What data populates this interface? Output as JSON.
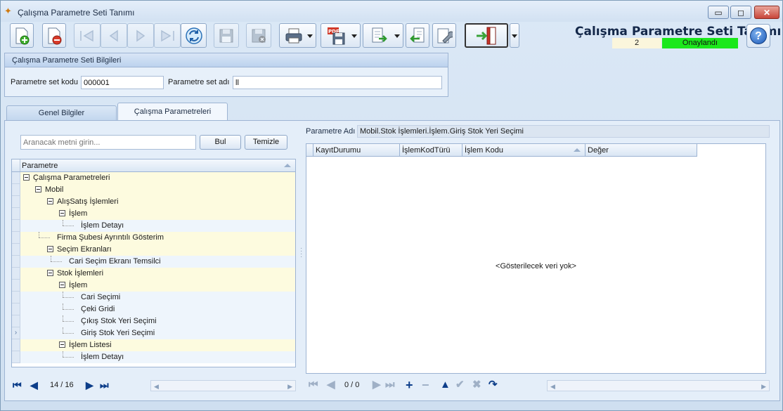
{
  "window": {
    "title": "Çalışma Parametre Seti Tanımı",
    "controls": {
      "minimize": "▭",
      "maximize": "◻",
      "close": "✕"
    }
  },
  "toolbar": {
    "buttons": [
      {
        "name": "new-record-button",
        "icon": "new-document-icon",
        "enabled": true
      },
      {
        "name": "delete-record-button",
        "icon": "delete-document-icon",
        "enabled": true
      },
      {
        "name": "first-record-button",
        "icon": "first-icon",
        "enabled": false
      },
      {
        "name": "prev-record-button",
        "icon": "prev-icon",
        "enabled": false
      },
      {
        "name": "next-record-button",
        "icon": "next-icon",
        "enabled": false
      },
      {
        "name": "last-record-button",
        "icon": "last-icon",
        "enabled": false
      },
      {
        "name": "refresh-button",
        "icon": "refresh-icon",
        "enabled": true
      },
      {
        "name": "save-button",
        "icon": "save-icon",
        "enabled": false
      },
      {
        "name": "cancel-save-button",
        "icon": "save-cancel-icon",
        "enabled": false
      },
      {
        "name": "print-button",
        "icon": "printer-icon",
        "enabled": true
      },
      {
        "name": "pdf-export-button",
        "icon": "pdf-icon",
        "enabled": true
      },
      {
        "name": "export-button",
        "icon": "export-icon",
        "enabled": true
      },
      {
        "name": "import-button",
        "icon": "import-icon",
        "enabled": true
      },
      {
        "name": "tools-button",
        "icon": "wrench-icon",
        "enabled": true
      },
      {
        "name": "exit-button",
        "icon": "exit-door-icon",
        "enabled": true
      }
    ]
  },
  "header": {
    "form_title": "Çalışma Parametre Seti Tanımı",
    "record_number": "2",
    "status": "Onaylandı",
    "status_color": "#1be81b",
    "help": "?"
  },
  "info_group": {
    "title": "Çalışma Parametre Seti Bilgileri",
    "code_label": "Parametre set kodu",
    "code_value": "000001",
    "name_label": "Parametre set adı",
    "name_value": "ll"
  },
  "tabs": [
    {
      "label": "Genel Bilgiler",
      "active": false
    },
    {
      "label": "Çalışma Parametreleri",
      "active": true
    }
  ],
  "left": {
    "search_placeholder": "Aranacak metni girin...",
    "find_button": "Bul",
    "clear_button": "Temizle",
    "tree_header": "Parametre",
    "rows": [
      {
        "label": "Çalışma Parametreleri",
        "level": 0,
        "expander": true,
        "tone": "yellow"
      },
      {
        "label": "Mobil",
        "level": 1,
        "expander": true,
        "tone": "yellow"
      },
      {
        "label": "AlışSatış İşlemleri",
        "level": 2,
        "expander": true,
        "tone": "yellow"
      },
      {
        "label": "İşlem",
        "level": 3,
        "expander": true,
        "tone": "yellow"
      },
      {
        "label": "İşlem Detayı",
        "level": 4,
        "expander": false,
        "tone": "blue"
      },
      {
        "label": "Firma Şubesi Ayrıntılı Gösterim",
        "level": 2,
        "expander": false,
        "tone": "yellow"
      },
      {
        "label": "Seçim Ekranları",
        "level": 2,
        "expander": true,
        "tone": "yellow"
      },
      {
        "label": "Cari Seçim Ekranı Temsilci",
        "level": 3,
        "expander": false,
        "tone": "blue"
      },
      {
        "label": "Stok İşlemleri",
        "level": 2,
        "expander": true,
        "tone": "yellow"
      },
      {
        "label": "İşlem",
        "level": 3,
        "expander": true,
        "tone": "yellow"
      },
      {
        "label": "Cari Seçimi",
        "level": 4,
        "expander": false,
        "tone": "blue"
      },
      {
        "label": "Çeki Gridi",
        "level": 4,
        "expander": false,
        "tone": "blue"
      },
      {
        "label": "Çıkış Stok Yeri Seçimi",
        "level": 4,
        "expander": false,
        "tone": "blue"
      },
      {
        "label": "Giriş Stok Yeri Seçimi",
        "level": 4,
        "expander": false,
        "tone": "blue",
        "current": true
      },
      {
        "label": "İşlem Listesi",
        "level": 3,
        "expander": true,
        "tone": "yellow"
      },
      {
        "label": "İşlem Detayı",
        "level": 4,
        "expander": false,
        "tone": "blue"
      }
    ],
    "record_count": "14 / 16"
  },
  "right": {
    "param_label": "Parametre Adı",
    "param_value": "Mobil.Stok İşlemleri.İşlem.Giriş Stok Yeri Seçimi",
    "columns": [
      "KayıtDurumu",
      "İşlemKodTürü",
      "İşlem Kodu",
      "Değer"
    ],
    "empty_message": "<Gösterilecek veri yok>",
    "record_count": "0 / 0"
  }
}
